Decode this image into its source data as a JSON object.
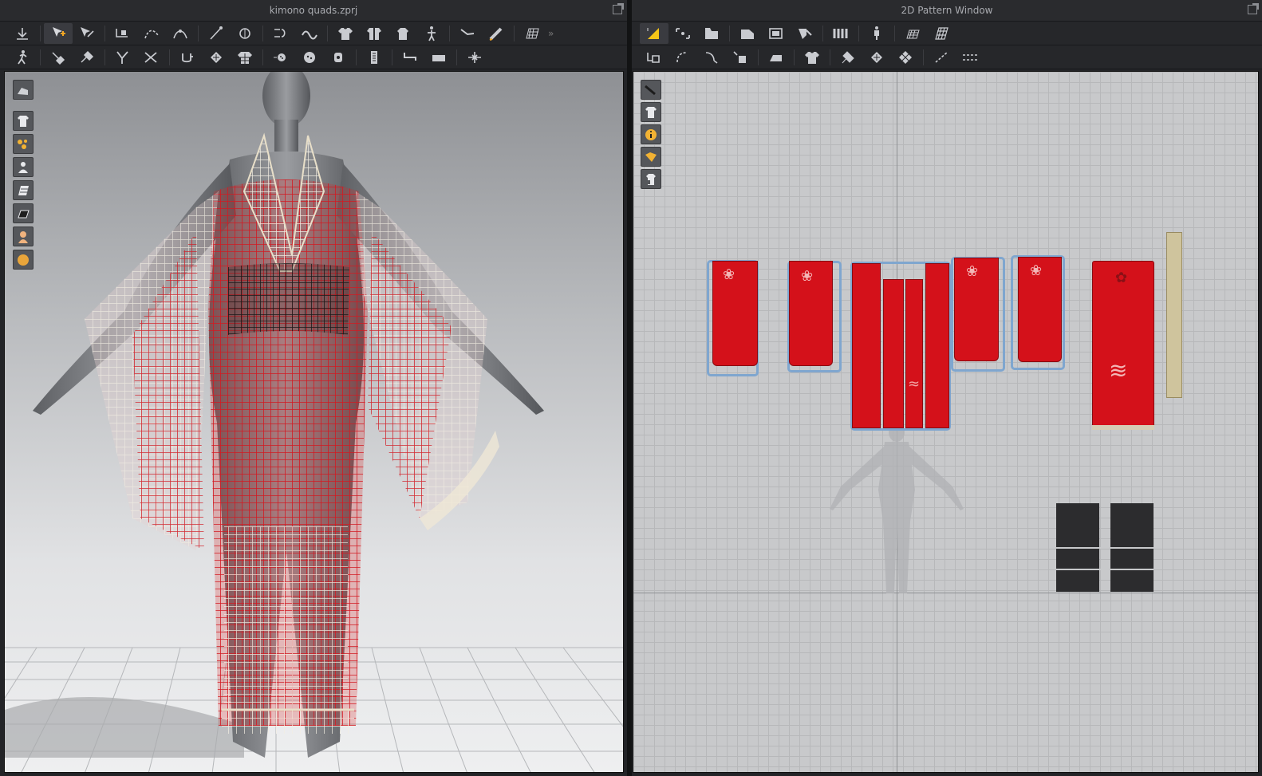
{
  "left_window": {
    "title": "kimono quads.zprj",
    "toolbar_row1_icons": [
      "move-down-icon",
      "transform-pattern-icon",
      "edit-pattern-icon",
      "add-point-icon",
      "curve-point-icon",
      "edit-curvature-icon",
      "sewing-line-icon",
      "segment-sewing-icon",
      "free-sewing-icon",
      "fold-arrangement-icon",
      "garment-shirt-icon",
      "garment-open-icon",
      "avatar-stand-icon",
      "avatar-pose-icon",
      "tape-measure-icon",
      "ruler-icon",
      "grid-mesh-icon"
    ],
    "toolbar_row2_icons": [
      "walk-avatar-icon",
      "pin-icon",
      "pin-tool-icon",
      "fold-tool-icon",
      "tack-icon",
      "steam-icon",
      "pattern-grid-icon",
      "shirt-grid-icon",
      "button-icon",
      "button-circle-icon",
      "buttonhole-icon",
      "zipper-icon",
      "puckering-icon",
      "flat-piece-icon",
      "snap-icon"
    ],
    "side_tools": [
      "scene-icon",
      "garment-view-icon",
      "texture-view-icon",
      "avatar-view-icon",
      "mesh-view-icon",
      "surface-view-icon",
      "skin-view-icon",
      "orange-sphere-icon"
    ]
  },
  "right_window": {
    "title": "2D Pattern Window",
    "toolbar_row1_icons": [
      "select-move-icon",
      "transform-pattern-icon",
      "edit-pattern-icon",
      "rectangle-icon",
      "polygon-icon",
      "internal-shape-icon",
      "layout-icon",
      "avatar-ref-icon",
      "grid-toggle-icon",
      "mesh-grid-icon"
    ],
    "toolbar_row2_icons": [
      "sewing-icon",
      "segment-sewing-icon",
      "free-sewing-icon",
      "check-sewing-icon",
      "iron-icon",
      "shirt-icon",
      "tack-icon",
      "grid-piece-icon",
      "checker-icon",
      "line-tool-icon",
      "dashed-line-icon"
    ],
    "side_tools": [
      "brush-icon",
      "garment-eye-icon",
      "info-icon",
      "folder-icon",
      "lock-shirt-icon"
    ]
  }
}
